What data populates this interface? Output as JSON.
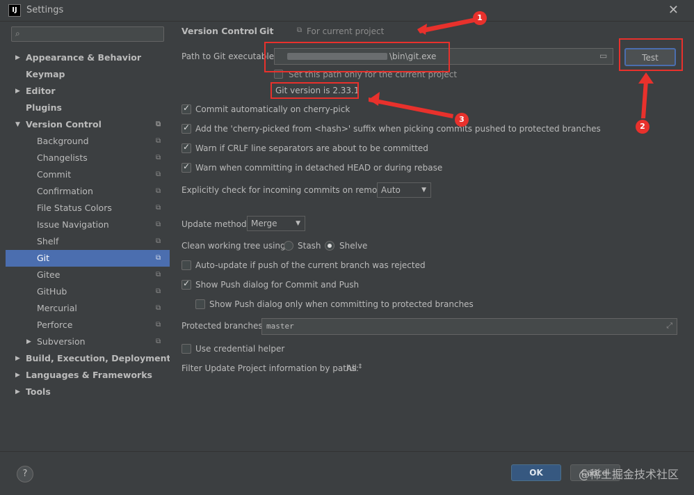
{
  "window": {
    "title": "Settings",
    "app_icon": "IJ"
  },
  "search": {
    "placeholder": ""
  },
  "sidebar": {
    "items": [
      {
        "label": "Appearance & Behavior"
      },
      {
        "label": "Keymap"
      },
      {
        "label": "Editor"
      },
      {
        "label": "Plugins"
      },
      {
        "label": "Version Control"
      },
      {
        "label": "Background"
      },
      {
        "label": "Changelists"
      },
      {
        "label": "Commit"
      },
      {
        "label": "Confirmation"
      },
      {
        "label": "File Status Colors"
      },
      {
        "label": "Issue Navigation"
      },
      {
        "label": "Shelf"
      },
      {
        "label": "Git"
      },
      {
        "label": "Gitee"
      },
      {
        "label": "GitHub"
      },
      {
        "label": "Mercurial"
      },
      {
        "label": "Perforce"
      },
      {
        "label": "Subversion"
      },
      {
        "label": "Build, Execution, Deployment"
      },
      {
        "label": "Languages & Frameworks"
      },
      {
        "label": "Tools"
      }
    ]
  },
  "breadcrumb": {
    "parent": "Version Control",
    "sep": "›",
    "current": "Git",
    "scope": "For current project"
  },
  "git_path": {
    "label": "Path to Git executable:",
    "value": "\\bin\\git.exe",
    "test_label": "Test",
    "set_only_label": "Set this path only for the current project",
    "version": "Git version is 2.33.1"
  },
  "options": {
    "commit_cherry": "Commit automatically on cherry-pick",
    "add_suffix": "Add the 'cherry-picked from <hash>' suffix when picking commits pushed to protected branches",
    "warn_crlf": "Warn if CRLF line separators are about to be committed",
    "warn_detached": "Warn when committing in detached HEAD or during rebase",
    "check_incoming_label": "Explicitly check for incoming commits on remotes:",
    "check_incoming_value": "Auto",
    "update_method_label": "Update method:",
    "update_method_value": "Merge",
    "clean_tree_label": "Clean working tree using:",
    "stash": "Stash",
    "shelve": "Shelve",
    "auto_update": "Auto-update if push of the current branch was rejected",
    "show_push": "Show Push dialog for Commit and Push",
    "show_push_protected": "Show Push dialog only when committing to protected branches",
    "protected_label": "Protected branches:",
    "protected_value": "master",
    "credential": "Use credential helper",
    "filter_label": "Filter Update Project information by paths:",
    "filter_value": "All"
  },
  "annotations": {
    "b1": "1",
    "b2": "2",
    "b3": "3"
  },
  "footer": {
    "ok": "OK",
    "cancel": "Cancel",
    "watermark": "@稀土掘金技术社区",
    "help": "?"
  },
  "colors": {
    "accent": "#4b6eaf",
    "annotation": "#e8312c"
  }
}
